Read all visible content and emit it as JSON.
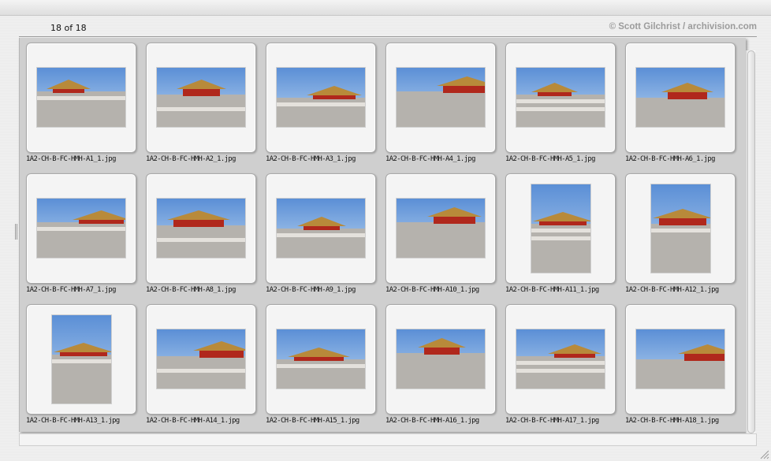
{
  "header": {
    "counter": "18 of 18",
    "credit": "© Scott Gilchrist / archivision.com"
  },
  "icons": {
    "resize": "resize-grip-icon",
    "splitter": "splitter-handle-icon"
  },
  "thumbnails": [
    {
      "filename": "1A2-CH-B-FC-HMH-A1_1.jpg",
      "orientation": "landscape"
    },
    {
      "filename": "1A2-CH-B-FC-HMH-A2_1.jpg",
      "orientation": "landscape"
    },
    {
      "filename": "1A2-CH-B-FC-HMH-A3_1.jpg",
      "orientation": "landscape"
    },
    {
      "filename": "1A2-CH-B-FC-HMH-A4_1.jpg",
      "orientation": "landscape"
    },
    {
      "filename": "1A2-CH-B-FC-HMH-A5_1.jpg",
      "orientation": "landscape"
    },
    {
      "filename": "1A2-CH-B-FC-HMH-A6_1.jpg",
      "orientation": "landscape"
    },
    {
      "filename": "1A2-CH-B-FC-HMH-A7_1.jpg",
      "orientation": "landscape"
    },
    {
      "filename": "1A2-CH-B-FC-HMH-A8_1.jpg",
      "orientation": "landscape"
    },
    {
      "filename": "1A2-CH-B-FC-HMH-A9_1.jpg",
      "orientation": "landscape"
    },
    {
      "filename": "1A2-CH-B-FC-HMH-A10_1.jpg",
      "orientation": "landscape"
    },
    {
      "filename": "1A2-CH-B-FC-HMH-A11_1.jpg",
      "orientation": "portrait"
    },
    {
      "filename": "1A2-CH-B-FC-HMH-A12_1.jpg",
      "orientation": "portrait"
    },
    {
      "filename": "1A2-CH-B-FC-HMH-A13_1.jpg",
      "orientation": "portrait"
    },
    {
      "filename": "1A2-CH-B-FC-HMH-A14_1.jpg",
      "orientation": "landscape"
    },
    {
      "filename": "1A2-CH-B-FC-HMH-A15_1.jpg",
      "orientation": "landscape"
    },
    {
      "filename": "1A2-CH-B-FC-HMH-A16_1.jpg",
      "orientation": "landscape"
    },
    {
      "filename": "1A2-CH-B-FC-HMH-A17_1.jpg",
      "orientation": "landscape"
    },
    {
      "filename": "1A2-CH-B-FC-HMH-A18_1.jpg",
      "orientation": "landscape"
    }
  ],
  "colors": {
    "sky": "#5b8fd6",
    "sky_light": "#b9d4f0",
    "roof": "#b88a3a",
    "pillar": "#b0281c",
    "stone": "#b5b2ad",
    "balustrade": "#e4e1dc"
  }
}
